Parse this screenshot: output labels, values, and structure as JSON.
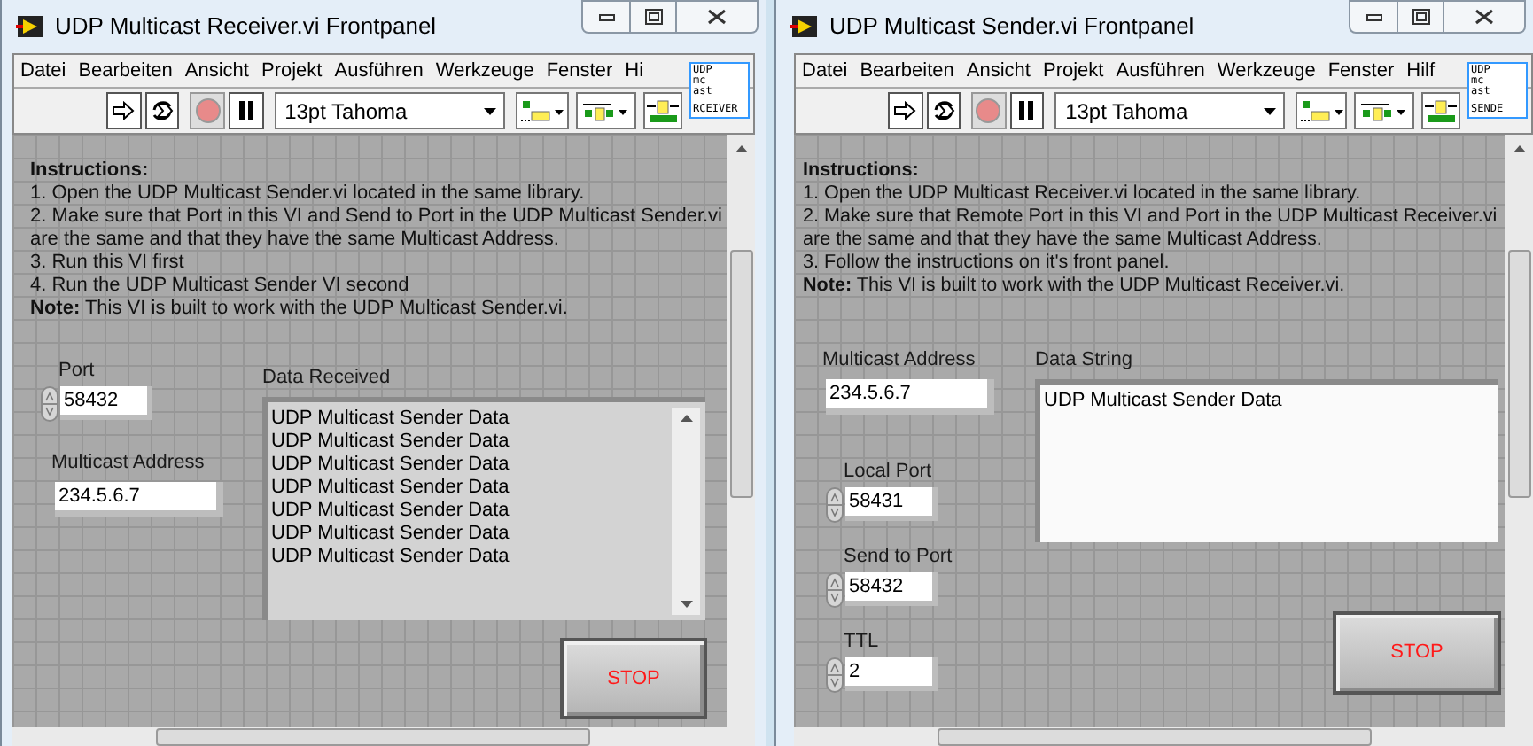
{
  "windows": [
    {
      "kind": "receiver",
      "title": "UDP Multicast Receiver.vi Frontpanel",
      "menu": [
        "Datei",
        "Bearbeiten",
        "Ansicht",
        "Projekt",
        "Ausführen",
        "Werkzeuge",
        "Fenster",
        "Hi"
      ],
      "font_selector": "13pt Tahoma",
      "vi_icon": [
        "UDP",
        "mc",
        "ast",
        "RCEIVER"
      ],
      "instructions": {
        "heading": "Instructions:",
        "lines": [
          "1. Open the UDP Multicast Sender.vi located in the same library.",
          "2. Make sure that Port in this VI and Send to Port in the UDP Multicast Sender.vi are the same and that they have the same Multicast Address.",
          "3. Run this VI first",
          "4. Run the UDP Multicast Sender VI second",
          "**Note:** This VI is built to work with the UDP Multicast Sender.vi."
        ]
      },
      "controls": [
        {
          "kind": "numeric",
          "label": "Port",
          "value": "58432"
        },
        {
          "kind": "string",
          "label": "Multicast Address",
          "value": "234.5.6.7"
        },
        {
          "kind": "listbox",
          "label": "Data Received",
          "lines": [
            "UDP Multicast Sender Data",
            "UDP Multicast Sender Data",
            "UDP Multicast Sender Data",
            "UDP Multicast Sender Data",
            "UDP Multicast Sender Data",
            "UDP Multicast Sender Data",
            "UDP Multicast Sender Data"
          ]
        },
        {
          "kind": "button",
          "label": "STOP"
        }
      ]
    },
    {
      "kind": "sender",
      "title": "UDP Multicast Sender.vi Frontpanel",
      "menu": [
        "Datei",
        "Bearbeiten",
        "Ansicht",
        "Projekt",
        "Ausführen",
        "Werkzeuge",
        "Fenster",
        "Hilf"
      ],
      "font_selector": "13pt Tahoma",
      "vi_icon": [
        "UDP",
        "mc",
        "ast",
        "SENDE"
      ],
      "instructions": {
        "heading": "Instructions:",
        "lines": [
          "1. Open the UDP Multicast Receiver.vi located in the same library.",
          "2. Make sure that Remote Port in this VI and Port in the UDP Multicast Receiver.vi are the same and that they have the same Multicast Address.",
          "3. Follow the instructions on it's front panel.",
          "**Note:** This VI is built to work with the UDP Multicast Receiver.vi."
        ]
      },
      "controls": [
        {
          "kind": "string",
          "label": "Multicast Address",
          "value": "234.5.6.7"
        },
        {
          "kind": "textbox",
          "label": "Data String",
          "value": "UDP Multicast Sender Data"
        },
        {
          "kind": "numeric",
          "label": "Local Port",
          "value": "58431"
        },
        {
          "kind": "numeric",
          "label": "Send to Port",
          "value": "58432"
        },
        {
          "kind": "numeric",
          "label": "TTL",
          "value": "2"
        },
        {
          "kind": "button",
          "label": "STOP"
        }
      ]
    }
  ]
}
